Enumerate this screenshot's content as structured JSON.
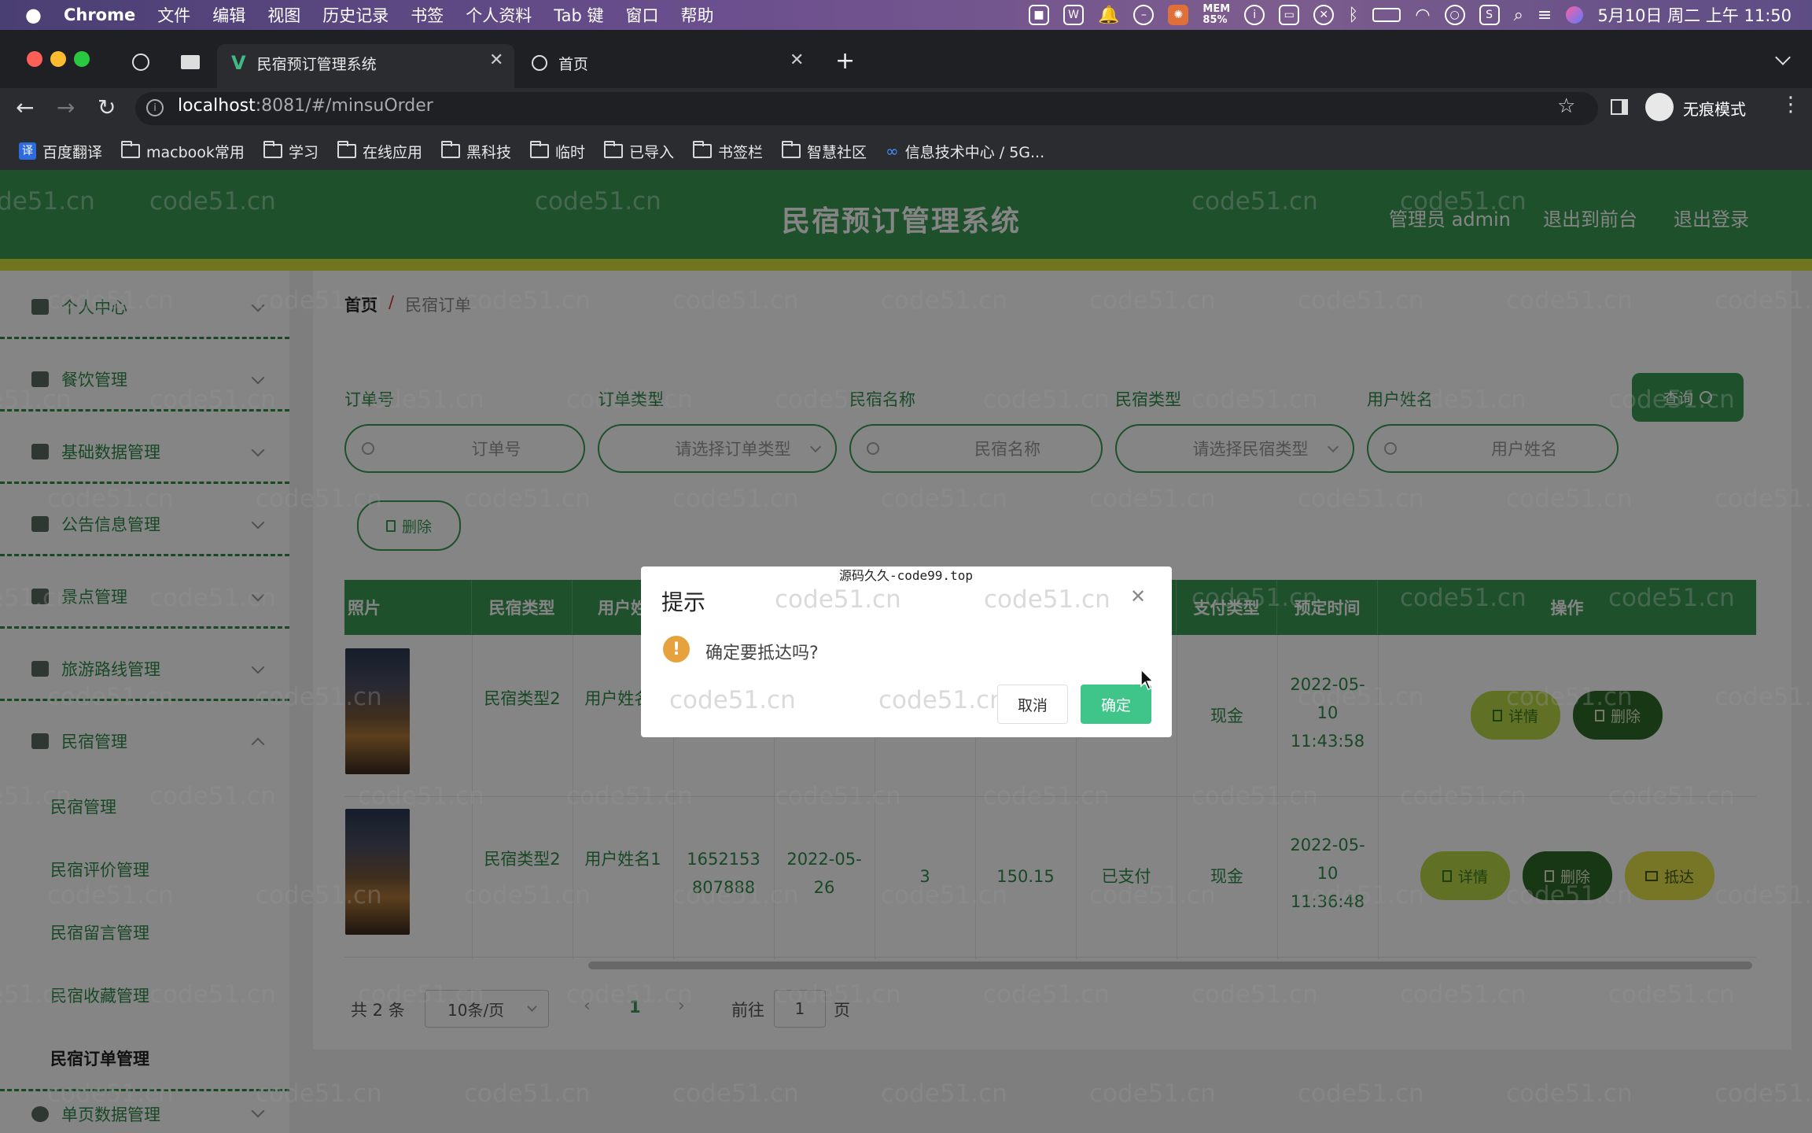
{
  "menubar": {
    "app": "Chrome",
    "items": [
      "文件",
      "编辑",
      "视图",
      "历史记录",
      "书签",
      "个人资料",
      "Tab 键",
      "窗口",
      "帮助"
    ],
    "mem": "MEM",
    "mem_pct": "85%",
    "datetime": "5月10日 周二 上午 11:50"
  },
  "browser": {
    "tabs": [
      {
        "title": "民宿预订管理系统",
        "active": true
      },
      {
        "title": "首页",
        "active": false
      }
    ],
    "url_host": "localhost",
    "url_rest": ":8081/#/minsuOrder",
    "profile": "无痕模式",
    "bookmarks": [
      "百度翻译",
      "macbook常用",
      "学习",
      "在线应用",
      "黑科技",
      "临时",
      "已导入",
      "书签栏",
      "智慧社区",
      "信息技术中心 / 5G..."
    ]
  },
  "header": {
    "title": "民宿预订管理系统",
    "admin": "管理员 admin",
    "back_front": "退出到前台",
    "logout": "退出登录"
  },
  "sidebar": {
    "items": [
      {
        "label": "个人中心",
        "icon": "user-icon"
      },
      {
        "label": "餐饮管理",
        "icon": "list-icon"
      },
      {
        "label": "基础数据管理",
        "icon": "clipboard-icon"
      },
      {
        "label": "公告信息管理",
        "icon": "chat-icon"
      },
      {
        "label": "景点管理",
        "icon": "user-icon"
      },
      {
        "label": "旅游路线管理",
        "icon": "chart-icon"
      },
      {
        "label": "民宿管理",
        "icon": "chat-icon"
      }
    ],
    "subitems": [
      "民宿管理",
      "民宿评价管理",
      "民宿留言管理",
      "民宿收藏管理",
      "民宿订单管理"
    ],
    "last_item": "单页数据管理"
  },
  "breadcrumb": {
    "home": "首页",
    "sep": "/",
    "current": "民宿订单"
  },
  "filters": {
    "labels": [
      "订单号",
      "订单类型",
      "民宿名称",
      "民宿类型",
      "用户姓名"
    ],
    "placeholders": [
      "订单号",
      "请选择订单类型",
      "民宿名称",
      "请选择民宿类型",
      "用户姓名"
    ],
    "query": "查询"
  },
  "delete_btn": "删除",
  "table": {
    "headers": [
      "照片",
      "民宿类型",
      "用户姓",
      "",
      "",
      "",
      "",
      "",
      "支付类型",
      "预定时间",
      "操作"
    ],
    "rows": [
      {
        "type": "民宿类型2",
        "user": "用户姓名1",
        "order_no": "",
        "date": "",
        "count": "",
        "price": "",
        "status": "",
        "pay": "现金",
        "time": "2022-05-10 11:43:58",
        "actions": [
          "详情",
          "删除"
        ]
      },
      {
        "type": "民宿类型2",
        "user": "用户姓名1",
        "order_no": "1652153807888",
        "date": "2022-05-26",
        "count": "3",
        "price": "150.15",
        "status": "已支付",
        "pay": "现金",
        "time": "2022-05-10 11:36:48",
        "actions": [
          "详情",
          "删除",
          "抵达"
        ]
      }
    ]
  },
  "pagination": {
    "total": "共 2 条",
    "per_page": "10条/页",
    "current": "1",
    "goto": "前往",
    "goto_value": "1",
    "page_suffix": "页"
  },
  "dialog": {
    "source": "源码久久-code99.top",
    "title": "提示",
    "message": "确定要抵达吗?",
    "cancel": "取消",
    "confirm": "确定"
  },
  "watermark": "code51.cn",
  "colors": {
    "primary": "#3a9a55",
    "accent_yellow": "#d8e23a",
    "warning": "#e6a23c",
    "confirm": "#3fc48a"
  }
}
